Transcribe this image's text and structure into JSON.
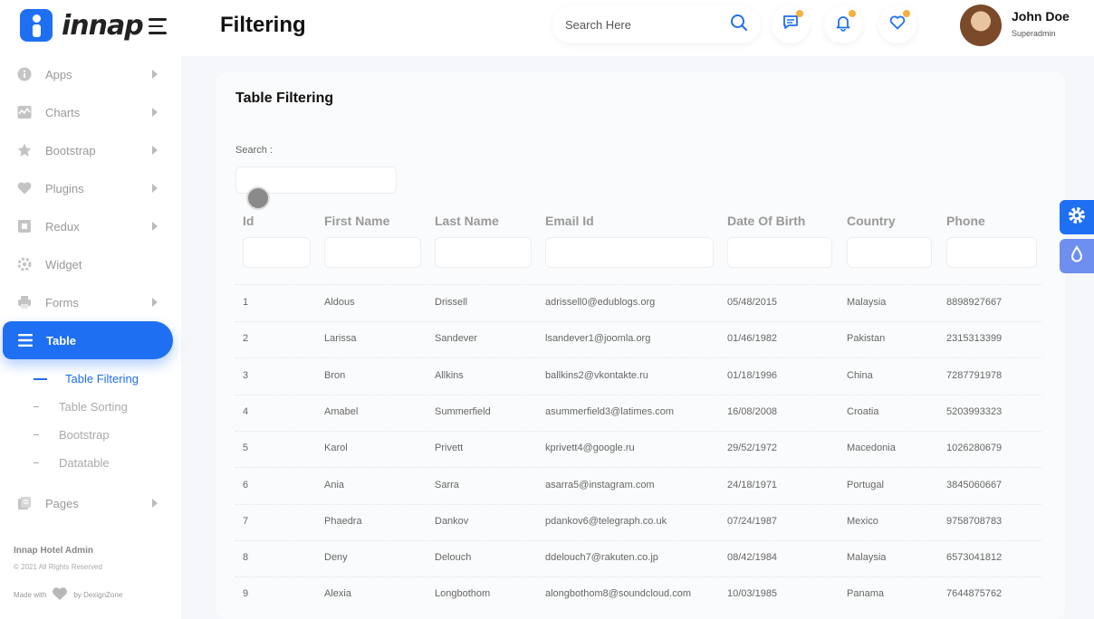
{
  "header": {
    "logo_text": "innap",
    "page_title": "Filtering",
    "search_placeholder": "Search Here",
    "user_name": "John Doe",
    "user_role": "Superadmin"
  },
  "sidebar": {
    "items": [
      {
        "label": "Apps",
        "icon": "info-icon"
      },
      {
        "label": "Charts",
        "icon": "chart-icon"
      },
      {
        "label": "Bootstrap",
        "icon": "star-icon"
      },
      {
        "label": "Plugins",
        "icon": "heart-icon"
      },
      {
        "label": "Redux",
        "icon": "square-icon"
      },
      {
        "label": "Widget",
        "icon": "settings-icon"
      },
      {
        "label": "Forms",
        "icon": "printer-icon"
      },
      {
        "label": "Table",
        "icon": "list-icon"
      },
      {
        "label": "Pages",
        "icon": "pages-icon"
      }
    ],
    "sub_items": [
      "Table Filtering",
      "Table Sorting",
      "Bootstrap",
      "Datatable"
    ],
    "footer_title": "Innap Hotel Admin",
    "footer_copy": "© 2021 All Rights Reserved",
    "footer_made_prefix": "Made with",
    "footer_made_suffix": "by DexignZone"
  },
  "card": {
    "title": "Table Filtering",
    "search_label": "Search :",
    "columns": [
      "Id",
      "First Name",
      "Last Name",
      "Email Id",
      "Date Of Birth",
      "Country",
      "Phone"
    ],
    "rows": [
      [
        "1",
        "Aldous",
        "Drissell",
        "adrissell0@edublogs.org",
        "05/48/2015",
        "Malaysia",
        "8898927667"
      ],
      [
        "2",
        "Larissa",
        "Sandever",
        "lsandever1@joomla.org",
        "01/46/1982",
        "Pakistan",
        "2315313399"
      ],
      [
        "3",
        "Bron",
        "Allkins",
        "ballkins2@vkontakte.ru",
        "01/18/1996",
        "China",
        "7287791978"
      ],
      [
        "4",
        "Amabel",
        "Summerfield",
        "asummerfield3@latimes.com",
        "16/08/2008",
        "Croatia",
        "5203993323"
      ],
      [
        "5",
        "Karol",
        "Privett",
        "kprivett4@google.ru",
        "29/52/1972",
        "Macedonia",
        "1026280679"
      ],
      [
        "6",
        "Ania",
        "Sarra",
        "asarra5@instagram.com",
        "24/18/1971",
        "Portugal",
        "3845060667"
      ],
      [
        "7",
        "Phaedra",
        "Dankov",
        "pdankov6@telegraph.co.uk",
        "07/24/1987",
        "Mexico",
        "9758708783"
      ],
      [
        "8",
        "Deny",
        "Delouch",
        "ddelouch7@rakuten.co.jp",
        "08/42/1984",
        "Malaysia",
        "6573041812"
      ],
      [
        "9",
        "Alexia",
        "Longbothom",
        "alongbothom8@soundcloud.com",
        "10/03/1985",
        "Panama",
        "7644875762"
      ]
    ]
  },
  "colors": {
    "accent": "#1f6ff2",
    "badge": "#f5b041",
    "float_secondary": "#6e8ff0"
  }
}
